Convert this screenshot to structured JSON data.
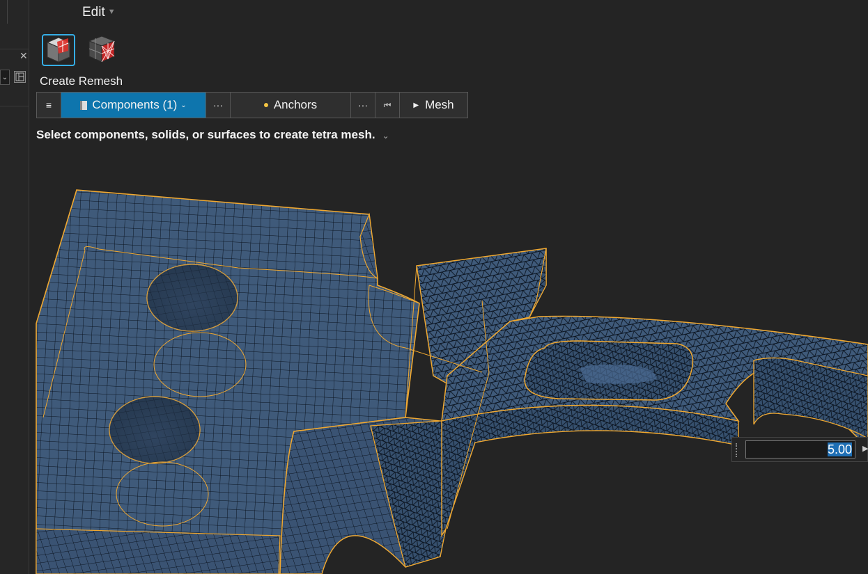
{
  "menu": {
    "edit_label": "Edit"
  },
  "tool": {
    "label": "Create Remesh"
  },
  "guide_bar": {
    "components_label": "Components (1)",
    "anchors_label": "Anchors",
    "mesh_label": "Mesh",
    "more_symbol": "···",
    "menu_symbol": "≡"
  },
  "instruction": "Select components, solids, or surfaces to create tetra mesh.",
  "element_size": {
    "value": "5.00"
  },
  "colors": {
    "accent_blue": "#0e75ad",
    "mesh_fill": "#3f5a7a",
    "feature_edge": "#f0a830",
    "background": "#242424"
  }
}
